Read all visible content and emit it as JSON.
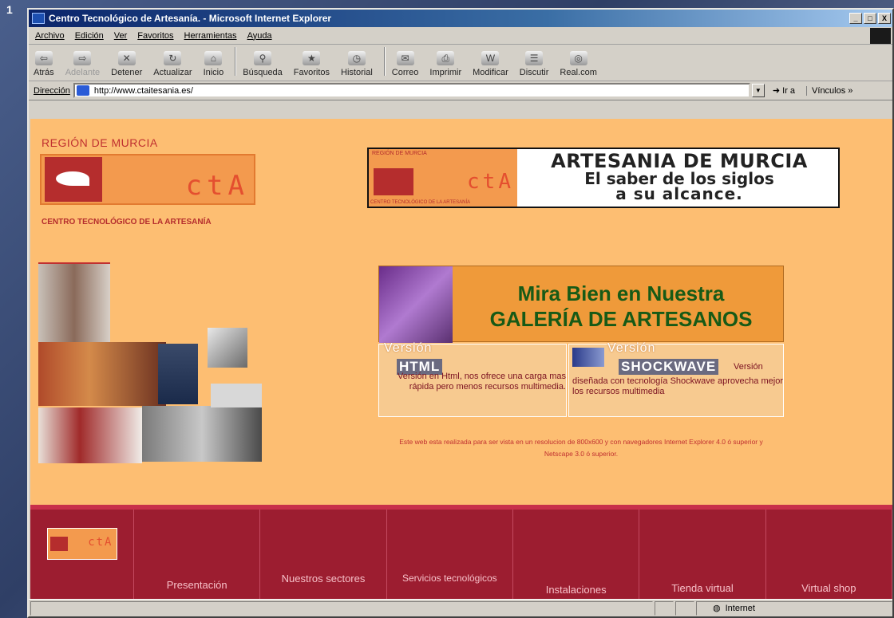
{
  "corner_number": "1",
  "window": {
    "title": "Centro Tecnológico de Artesanía. - Microsoft Internet Explorer",
    "controls": [
      "_",
      "□",
      "X"
    ]
  },
  "menu": [
    "Archivo",
    "Edición",
    "Ver",
    "Favoritos",
    "Herramientas",
    "Ayuda"
  ],
  "toolbar": {
    "buttons": [
      {
        "label": "Atrás",
        "icon": "back-arrow-icon"
      },
      {
        "label": "Adelante",
        "icon": "forward-arrow-icon"
      },
      {
        "label": "Detener",
        "icon": "stop-icon"
      },
      {
        "label": "Actualizar",
        "icon": "refresh-icon"
      },
      {
        "label": "Inicio",
        "icon": "home-icon"
      },
      {
        "label": "Búsqueda",
        "icon": "search-icon"
      },
      {
        "label": "Favoritos",
        "icon": "favorites-folder-icon"
      },
      {
        "label": "Historial",
        "icon": "history-icon"
      },
      {
        "label": "Correo",
        "icon": "mail-icon"
      },
      {
        "label": "Imprimir",
        "icon": "printer-icon"
      },
      {
        "label": "Modificar",
        "icon": "edit-icon"
      },
      {
        "label": "Discutir",
        "icon": "discuss-icon"
      },
      {
        "label": "Real.com",
        "icon": "realcom-icon"
      }
    ]
  },
  "address": {
    "label": "Dirección",
    "url": "http://www.ctaitesania.es/",
    "go": "Ir a",
    "links": "Vínculos »"
  },
  "page": {
    "region": "REGIÓN DE MURCIA",
    "logo_text": "ctA",
    "logo_subtitle": "CENTRO TECNOLÓGICO DE LA ARTESANÍA",
    "banner": {
      "small_region": "REGIÓN DE MURCIA",
      "small_logo": "ctA",
      "small_sub": "CENTRO TECNOLÓGICO DE LA ARTESANÍA",
      "line1": "ARTESANIA DE MURCIA",
      "line2": "El saber de los siglos",
      "line3": "a su alcance."
    },
    "gallery": {
      "line1": "Mira Bien en Nuestra",
      "line2": "GALERÍA DE ARTESANOS"
    },
    "version_html": {
      "label": "Versión",
      "big": "HTML",
      "desc": "Versión en Html, nos ofrece una carga mas rápida pero menos recursos multimedia."
    },
    "version_shockwave": {
      "label": "Versión",
      "big": "SHOCKWAVE",
      "desc_word": "Versión",
      "desc": "diseñada con tecnología Shockwave aprovecha mejor los recursos multimedia"
    },
    "note": "Este web esta realizada para ser vista en un resolucion de 800x600 y con navegadores Internet Explorer 4.0 ó superior y Netscape 3.0 ó superior."
  },
  "nav": {
    "logo_text": "ctA",
    "items": [
      "Presentación",
      "Nuestros sectores",
      "Servicios tecnológicos",
      "Instalaciones",
      "Tienda virtual",
      "Virtual shop"
    ]
  },
  "status": {
    "zone": "Internet"
  },
  "colors": {
    "page_bg": "#fdbe72",
    "brand_red": "#9c1d30",
    "gallery_green": "#175a16",
    "title_blue": "#0a246a"
  }
}
